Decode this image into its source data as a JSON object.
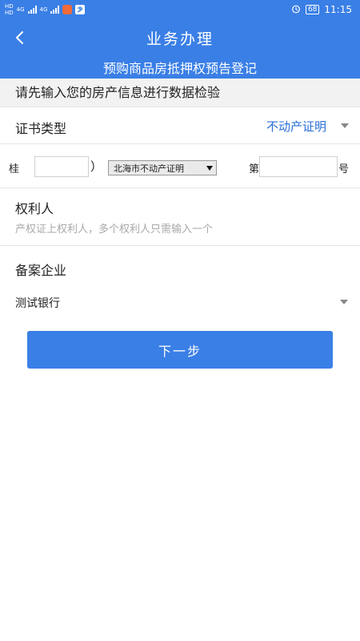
{
  "status_bar": {
    "network_hd1": "HD",
    "network_hd2": "HD",
    "network_4g1": "4G",
    "network_4g2": "4G",
    "battery": "68",
    "time": "11:15",
    "icons": [
      "signal-icon",
      "app-notification-icon",
      "alipay-icon",
      "alarm-icon",
      "battery-icon"
    ]
  },
  "header": {
    "back_icon": "chevron-left-icon",
    "title": "业务办理",
    "subtitle": "预购商品房抵押权预告登记"
  },
  "notice": "请先输入您的房产信息进行数据检验",
  "certificate_type": {
    "label": "证书类型",
    "value": "不动产证明"
  },
  "certificate_number": {
    "prefix": "桂",
    "paren_open": "（",
    "paren_close": "）",
    "year_value": "",
    "region_selected": "北海市不动产证明",
    "di": "第",
    "number_value": "",
    "hao": "号"
  },
  "owner": {
    "label": "权利人",
    "placeholder": "产权证上权利人，多个权利人只需输入一个"
  },
  "filing_company": {
    "label": "备案企业",
    "value": "测试银行"
  },
  "next_button": "下一步",
  "colors": {
    "primary": "#3a7fe6",
    "link": "#2a6fd6"
  }
}
